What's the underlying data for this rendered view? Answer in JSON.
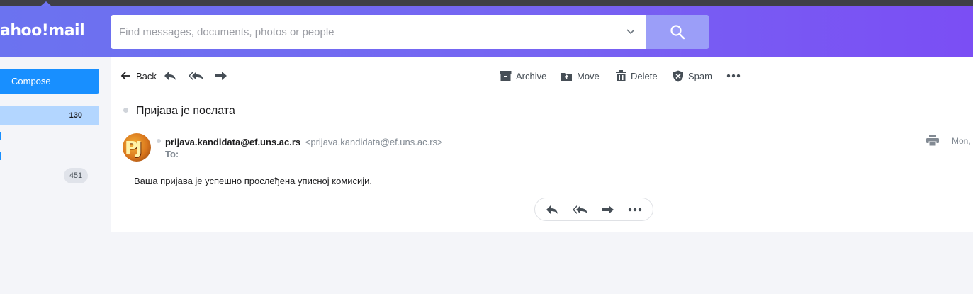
{
  "app": {
    "logo_text": "ahoo!mail",
    "accent": "#188fff",
    "header_gradient": [
      "#6b73f0",
      "#7b4ef4"
    ]
  },
  "search": {
    "placeholder": "Find messages, documents, photos or people",
    "value": "",
    "icons": {
      "dropdown": "chevron-down-icon",
      "submit": "search-icon"
    }
  },
  "sidebar": {
    "compose_label": "Compose",
    "inbox_count": "130",
    "folder_badge": "451"
  },
  "toolbar": {
    "back_label": "Back",
    "archive_label": "Archive",
    "move_label": "Move",
    "delete_label": "Delete",
    "spam_label": "Spam"
  },
  "message": {
    "subject": "Пријава је послата",
    "sender_name": "prijava.kandidata@ef.uns.ac.rs",
    "sender_email": "<prijava.kandidata@ef.uns.ac.rs>",
    "to_label": "To:",
    "date": "Mon,",
    "avatar_initials": "PJ",
    "body": "Ваша пријава је успешно прослеђена уписној комисији."
  }
}
